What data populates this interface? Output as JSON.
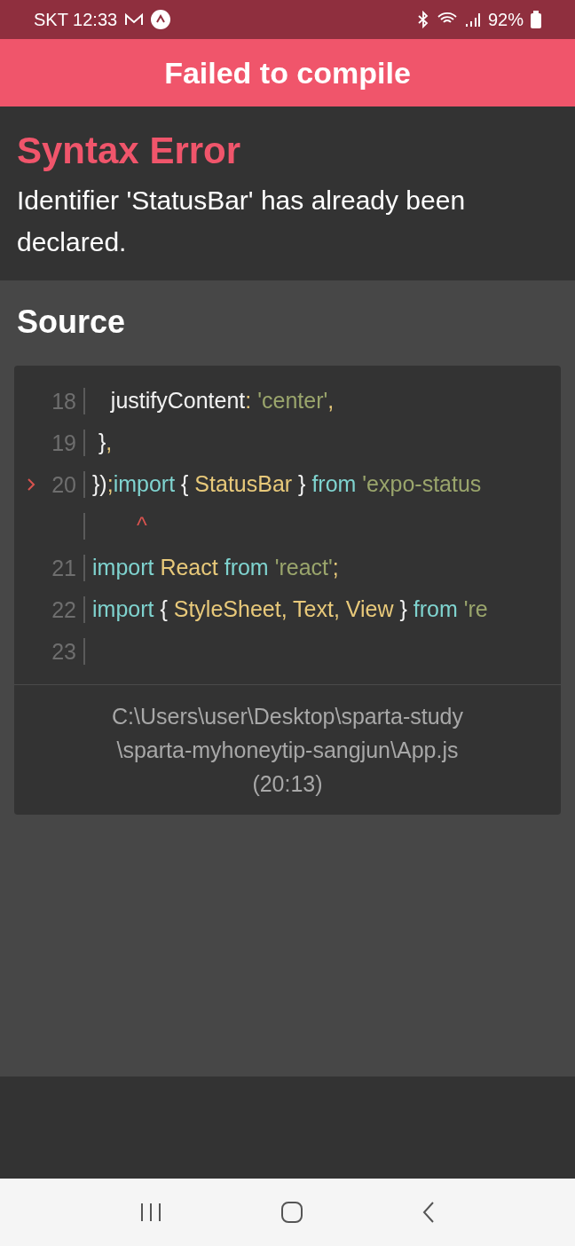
{
  "status_bar": {
    "carrier_time": "SKT 12:33",
    "battery": "92%"
  },
  "header": {
    "title": "Failed to compile"
  },
  "error": {
    "title": "Syntax Error",
    "message": "Identifier 'StatusBar' has already been declared."
  },
  "source": {
    "title": "Source",
    "lines": [
      {
        "number": "18",
        "highlighted": false,
        "tokens": [
          {
            "kind": "plain",
            "text": "   justifyContent"
          },
          {
            "kind": "punct",
            "text": ": "
          },
          {
            "kind": "string",
            "text": "'center'"
          },
          {
            "kind": "punct",
            "text": ","
          }
        ]
      },
      {
        "number": "19",
        "highlighted": false,
        "tokens": [
          {
            "kind": "plain",
            "text": " }"
          },
          {
            "kind": "punct",
            "text": ","
          }
        ]
      },
      {
        "number": "20",
        "highlighted": true,
        "tokens": [
          {
            "kind": "plain",
            "text": "})"
          },
          {
            "kind": "punct",
            "text": ";"
          },
          {
            "kind": "keyword",
            "text": "import"
          },
          {
            "kind": "plain",
            "text": " { "
          },
          {
            "kind": "identifier",
            "text": "StatusBar"
          },
          {
            "kind": "plain",
            "text": " } "
          },
          {
            "kind": "keyword",
            "text": "from"
          },
          {
            "kind": "string",
            "text": " 'expo-status"
          }
        ]
      },
      {
        "highlighted": false,
        "caret": "^"
      },
      {
        "number": "21",
        "highlighted": false,
        "tokens": [
          {
            "kind": "keyword",
            "text": "import"
          },
          {
            "kind": "identifier",
            "text": " React"
          },
          {
            "kind": "keyword",
            "text": " from"
          },
          {
            "kind": "string",
            "text": " 'react'"
          },
          {
            "kind": "punct",
            "text": ";"
          }
        ]
      },
      {
        "number": "22",
        "highlighted": false,
        "tokens": [
          {
            "kind": "keyword",
            "text": "import"
          },
          {
            "kind": "plain",
            "text": " { "
          },
          {
            "kind": "identifier",
            "text": "StyleSheet, Text, View"
          },
          {
            "kind": "plain",
            "text": " } "
          },
          {
            "kind": "keyword",
            "text": "from"
          },
          {
            "kind": "string",
            "text": " 're"
          }
        ]
      },
      {
        "number": "23",
        "highlighted": false
      }
    ],
    "file": "C:\\Users\\user\\Desktop\\sparta-study\n\\sparta-myhoneytip-sangjun\\App.js\n(20:13)"
  }
}
